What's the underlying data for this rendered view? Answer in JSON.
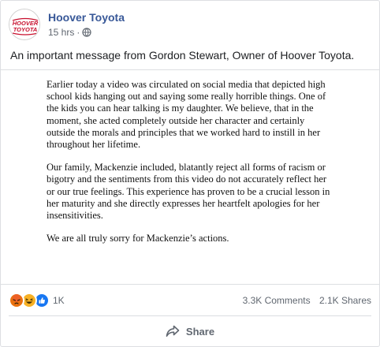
{
  "post": {
    "page_name": "Hoover Toyota",
    "avatar_logo_text": "HOOVER TOYOTA",
    "time": "15 hrs",
    "privacy_icon": "globe-icon",
    "caption": "An important message from Gordon Stewart, Owner of Hoover Toyota.",
    "statement_paragraphs": [
      "Earlier today a video was circulated on social media that depicted high school kids hanging out and saying some really horrible things.  One of the kids you can hear talking is my daughter.  We believe, that in the moment, she acted completely outside her character and certainly outside the morals and principles that we worked hard to instill in her throughout her lifetime.",
      "Our family, Mackenzie included, blatantly reject all forms of racism or bigotry and the sentiments from this video do not accurately reflect her or our true feelings. This experience has proven to be a crucial lesson in her maturity and she directly expresses her heartfelt apologies for her insensitivities.",
      "We are all truly sorry for Mackenzie’s actions."
    ]
  },
  "stats": {
    "reaction_icons": [
      "angry-reaction-icon",
      "haha-reaction-icon",
      "like-reaction-icon"
    ],
    "reaction_count": "1K",
    "comments": "3.3K Comments",
    "shares": "2.1K Shares"
  },
  "actions": {
    "share_label": "Share",
    "share_icon": "share-arrow-icon"
  },
  "colors": {
    "page_name": "#385898",
    "logo_red": "#c8102e",
    "angry": "#e9710f",
    "haha": "#f7b125",
    "like": "#1877f2"
  }
}
